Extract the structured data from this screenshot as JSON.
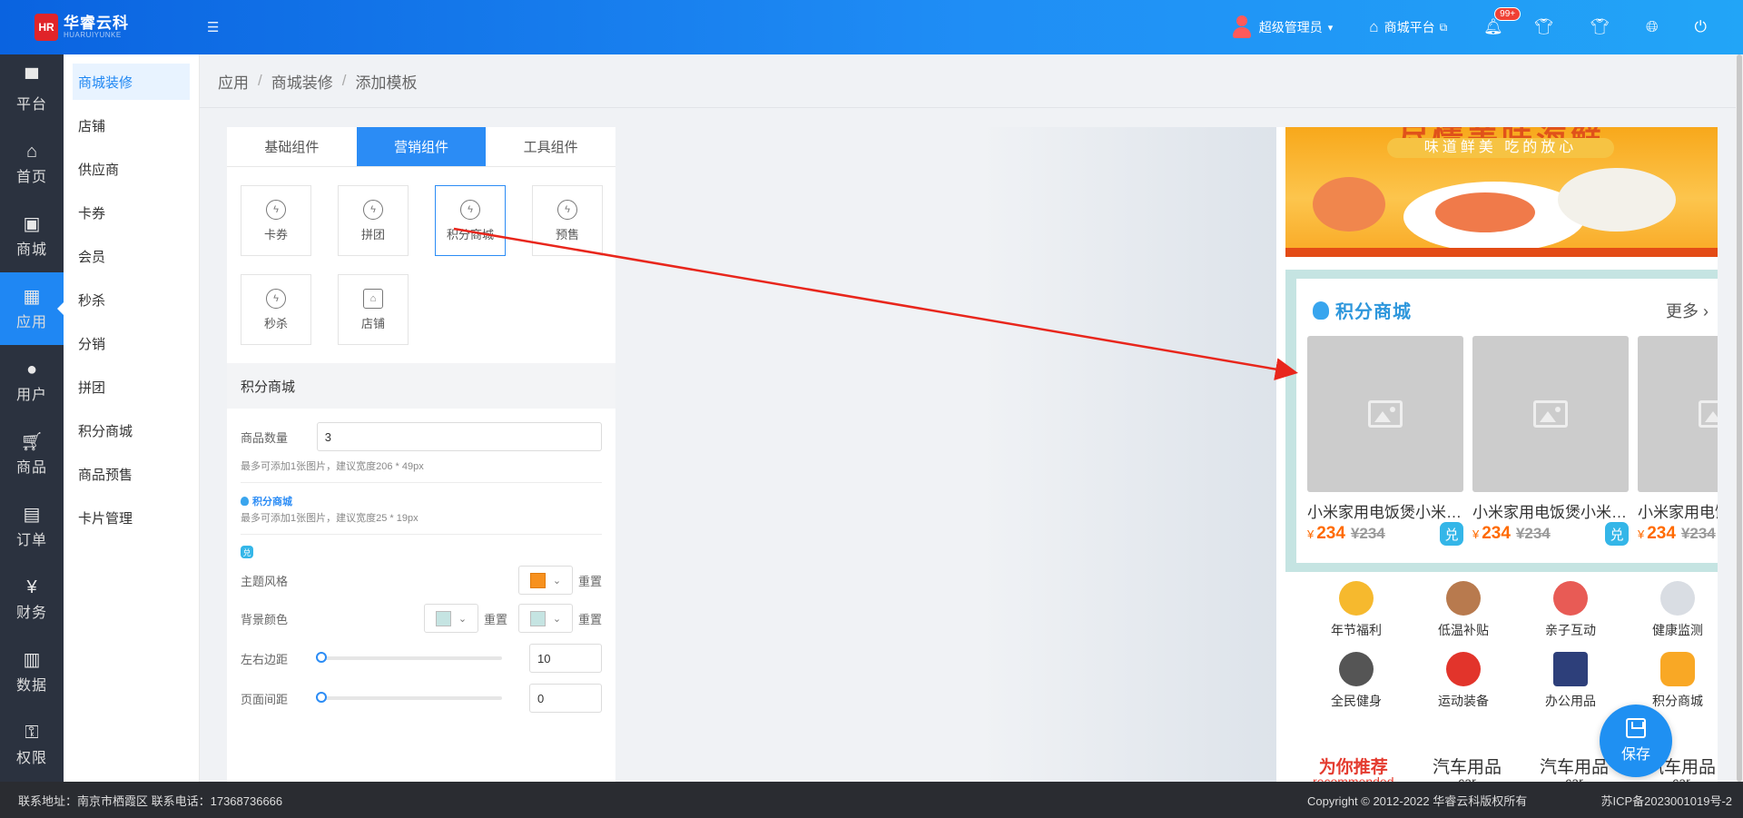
{
  "header": {
    "logo_mark": "HR",
    "brand": "华睿云科",
    "brand_sub": "HUARUIYUNKE",
    "user": "超级管理员",
    "mall_link": "商城平台",
    "notice_badge": "99+",
    "accent": "#1f87f3"
  },
  "leftnav": [
    {
      "label": "平台",
      "icon": "monitor-icon"
    },
    {
      "label": "首页",
      "icon": "home-icon"
    },
    {
      "label": "商城",
      "icon": "bag-icon"
    },
    {
      "label": "应用",
      "icon": "grid-icon"
    },
    {
      "label": "用户",
      "icon": "user-icon"
    },
    {
      "label": "商品",
      "icon": "cart-icon"
    },
    {
      "label": "订单",
      "icon": "order-icon"
    },
    {
      "label": "财务",
      "icon": "yen-icon"
    },
    {
      "label": "数据",
      "icon": "chart-icon"
    },
    {
      "label": "权限",
      "icon": "lock-user-icon"
    }
  ],
  "subnav": [
    "商城装修",
    "店铺",
    "供应商",
    "卡券",
    "会员",
    "秒杀",
    "分销",
    "拼团",
    "积分商城",
    "商品预售",
    "卡片管理"
  ],
  "breadcrumb": [
    "应用",
    "商城装修",
    "添加模板"
  ],
  "panel": {
    "tabs": [
      "基础组件",
      "营销组件",
      "工具组件"
    ],
    "components": [
      "卡券",
      "拼团",
      "积分商城",
      "预售",
      "秒杀",
      "店铺"
    ],
    "section_title": "积分商城",
    "form": {
      "qty_label": "商品数量",
      "qty_value": "3",
      "hint1": "最多可添加1张图片，建议宽度206 * 49px",
      "mini_title": "积分商城",
      "hint2": "最多可添加1张图片，建议宽度25 * 19px",
      "dui": "兑",
      "theme_label": "主题风格",
      "bg_label": "背景颜色",
      "reset": "重置",
      "lr_label": "左右边距",
      "lr_value": "10",
      "gap_label": "页面间距",
      "gap_value": "0",
      "theme_color": "#f7911e",
      "bg_color": "#c5e4e2"
    }
  },
  "preview": {
    "banner_title": "尽情美味海鲜",
    "banner_sub": "味道鲜美  吃的放心",
    "pm_title": "积分商城",
    "pm_more": "更多",
    "products": [
      {
        "name": "小米家用电饭煲小米电饭煲",
        "price": "234",
        "old": "¥234",
        "tag": "兑"
      },
      {
        "name": "小米家用电饭煲小米电饭煲",
        "price": "234",
        "old": "¥234",
        "tag": "兑"
      },
      {
        "name": "小米家用电饭煲小米电饭煲",
        "price": "234",
        "old": "¥234",
        "tag": "兑"
      }
    ],
    "currency": "¥",
    "grid": [
      "年节福利",
      "低温补贴",
      "亲子互动",
      "健康监测",
      "全民健身",
      "运动装备",
      "办公用品",
      "积分商城"
    ],
    "rec_main": "为你推荐",
    "rec_main_en": "recommended",
    "rec_items": [
      {
        "t": "汽车用品",
        "en": "car"
      },
      {
        "t": "汽车用品",
        "en": "car"
      },
      {
        "t": "汽车用品",
        "en": "car"
      }
    ],
    "save": "保存"
  },
  "footer": {
    "left": "联系地址：南京市栖霞区 联系电话：17368736666",
    "center": "Copyright © 2012-2022 华睿云科版权所有",
    "right": "苏ICP备2023001019号-2"
  }
}
